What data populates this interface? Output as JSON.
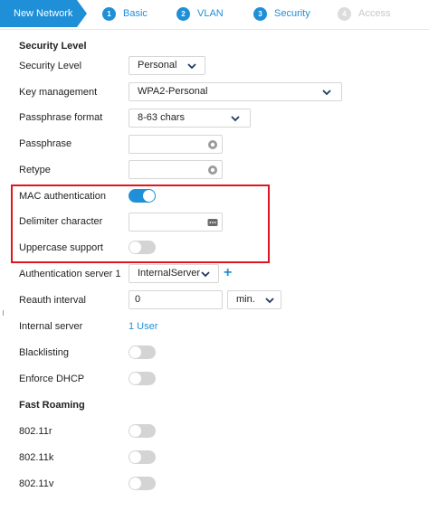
{
  "wizard": {
    "first_label": "New Network",
    "steps": [
      {
        "num": "1",
        "label": "Basic"
      },
      {
        "num": "2",
        "label": "VLAN"
      },
      {
        "num": "3",
        "label": "Security"
      },
      {
        "num": "4",
        "label": "Access"
      }
    ]
  },
  "security": {
    "section_title": "Security Level",
    "security_level": {
      "label": "Security Level",
      "value": "Personal"
    },
    "key_management": {
      "label": "Key management",
      "value": "WPA2-Personal"
    },
    "passphrase_format": {
      "label": "Passphrase format",
      "value": "8-63 chars"
    },
    "passphrase": {
      "label": "Passphrase",
      "value": ""
    },
    "retype": {
      "label": "Retype",
      "value": ""
    },
    "mac_auth": {
      "label": "MAC authentication",
      "enabled": true
    },
    "delimiter": {
      "label": "Delimiter character",
      "value": ""
    },
    "uppercase": {
      "label": "Uppercase support",
      "enabled": false
    },
    "auth_server": {
      "label": "Authentication server 1",
      "value": "InternalServer"
    },
    "reauth": {
      "label": "Reauth interval",
      "value": "0",
      "unit": "min."
    },
    "internal_server": {
      "label": "Internal server",
      "link": "1 User"
    },
    "blacklisting": {
      "label": "Blacklisting",
      "enabled": false
    },
    "enforce_dhcp": {
      "label": "Enforce DHCP",
      "enabled": false
    }
  },
  "fast_roaming": {
    "section_title": "Fast Roaming",
    "r": {
      "label": "802.11r",
      "enabled": false
    },
    "k": {
      "label": "802.11k",
      "enabled": false
    },
    "v": {
      "label": "802.11v",
      "enabled": false
    }
  },
  "colors": {
    "accent": "#1f8fd8",
    "highlight_border": "#e0161e"
  }
}
